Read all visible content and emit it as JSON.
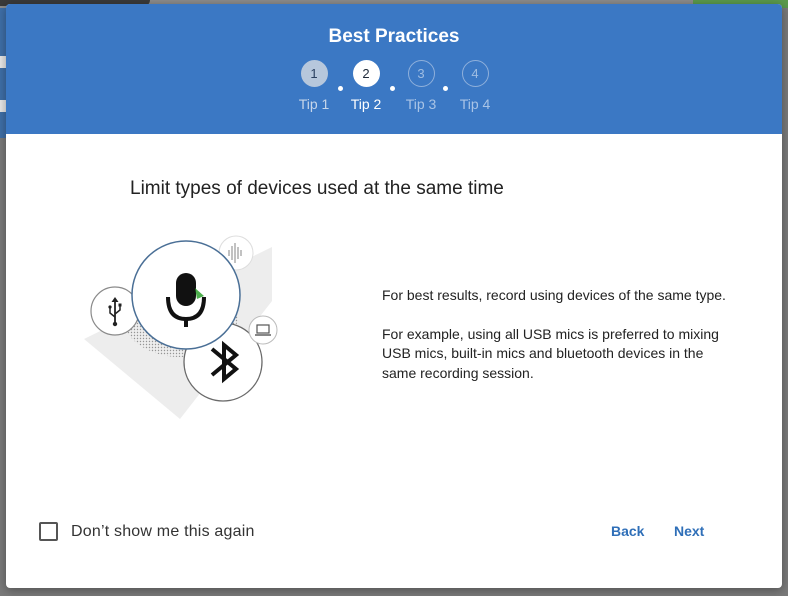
{
  "dialog": {
    "title": "Best Practices",
    "steps": [
      {
        "number": "1",
        "label": "Tip 1",
        "state": "done"
      },
      {
        "number": "2",
        "label": "Tip 2",
        "state": "active"
      },
      {
        "number": "3",
        "label": "Tip 3",
        "state": "todo"
      },
      {
        "number": "4",
        "label": "Tip 4",
        "state": "todo"
      }
    ],
    "heading": "Limit types of devices used at the same time",
    "paragraphs": [
      "For best results, record using devices of the same type.",
      "For example, using all USB mics is preferred to mixing USB mics, built-in mics and bluetooth devices in the same recording session."
    ],
    "checkbox_label": "Don’t show me this again",
    "back_label": "Back",
    "next_label": "Next"
  },
  "colors": {
    "header": "#3b78c4",
    "accent": "#2f6fb8"
  },
  "icons": [
    "usb-icon",
    "microphone-icon",
    "bluetooth-icon",
    "waveform-icon",
    "laptop-icon"
  ]
}
